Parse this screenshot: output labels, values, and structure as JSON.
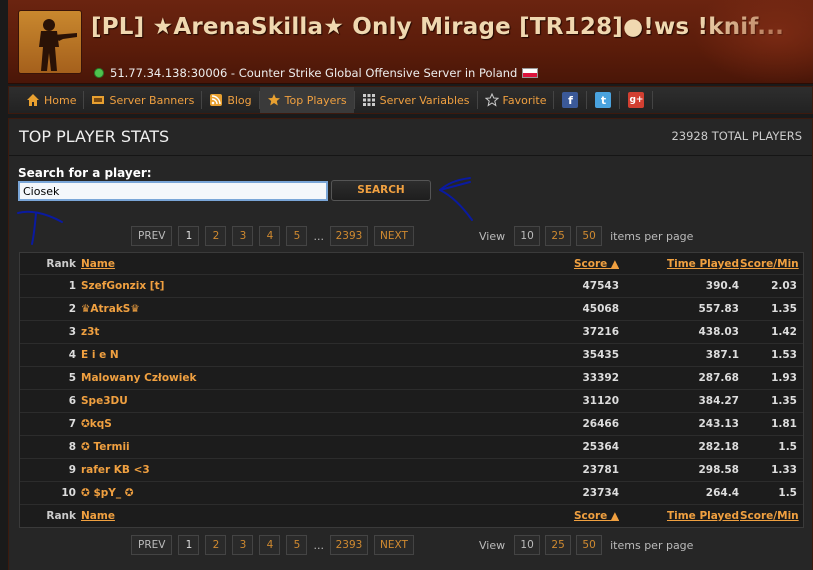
{
  "header": {
    "server_name": "[PL] ★ArenaSkilla★ Only Mirage [TR128]●!ws !knif...",
    "server_info": "51.77.34.138:30006 - Counter Strike Global Offensive Server in Poland"
  },
  "nav": {
    "items": [
      {
        "label": "Home",
        "icon": "home-icon"
      },
      {
        "label": "Server Banners",
        "icon": "banner-icon"
      },
      {
        "label": "Blog",
        "icon": "rss-icon"
      },
      {
        "label": "Top Players",
        "icon": "star-icon"
      },
      {
        "label": "Server Variables",
        "icon": "grid-icon"
      },
      {
        "label": "Favorite",
        "icon": "star-outline-icon"
      }
    ],
    "social": [
      "facebook-icon",
      "twitter-icon",
      "google-plus-icon"
    ]
  },
  "panel": {
    "title": "TOP PLAYER STATS",
    "total": "23928 TOTAL PLAYERS"
  },
  "search": {
    "label": "Search for a player:",
    "value": "Ciosek",
    "button": "SEARCH"
  },
  "pager": {
    "prev": "PREV",
    "pages": [
      "1",
      "2",
      "3",
      "4",
      "5"
    ],
    "ellipsis": "...",
    "last": "2393",
    "next": "NEXT",
    "view_label": "View",
    "per_page": [
      "10",
      "25",
      "50"
    ],
    "per_page_suffix": "items per page"
  },
  "table": {
    "headers": {
      "rank": "Rank",
      "name": "Name",
      "score": "Score ▲",
      "time": "Time Played",
      "spm": "Score/Min"
    },
    "rows": [
      {
        "rank": "1",
        "name": "SzefGonzix [t]",
        "score": "47543",
        "time": "390.4",
        "spm": "2.03"
      },
      {
        "rank": "2",
        "name": "♛AtrakS♛",
        "score": "45068",
        "time": "557.83",
        "spm": "1.35"
      },
      {
        "rank": "3",
        "name": "z3t",
        "score": "37216",
        "time": "438.03",
        "spm": "1.42"
      },
      {
        "rank": "4",
        "name": "E i e N",
        "score": "35435",
        "time": "387.1",
        "spm": "1.53"
      },
      {
        "rank": "5",
        "name": "Malowany Człowiek",
        "score": "33392",
        "time": "287.68",
        "spm": "1.93"
      },
      {
        "rank": "6",
        "name": "Spe3DU",
        "score": "31120",
        "time": "384.27",
        "spm": "1.35"
      },
      {
        "rank": "7",
        "name": "✪kqS",
        "score": "26466",
        "time": "243.13",
        "spm": "1.81"
      },
      {
        "rank": "8",
        "name": "✪ Termii",
        "score": "25364",
        "time": "282.18",
        "spm": "1.5"
      },
      {
        "rank": "9",
        "name": "rafer KB <3",
        "score": "23781",
        "time": "298.58",
        "spm": "1.33"
      },
      {
        "rank": "10",
        "name": "✪ $pY_ ✪",
        "score": "23734",
        "time": "264.4",
        "spm": "1.5"
      }
    ]
  },
  "colors": {
    "accent": "#f0a040",
    "header_bg": "#5a1c0a",
    "panel_bg": "#262626",
    "annotation": "#0a1aa0"
  }
}
